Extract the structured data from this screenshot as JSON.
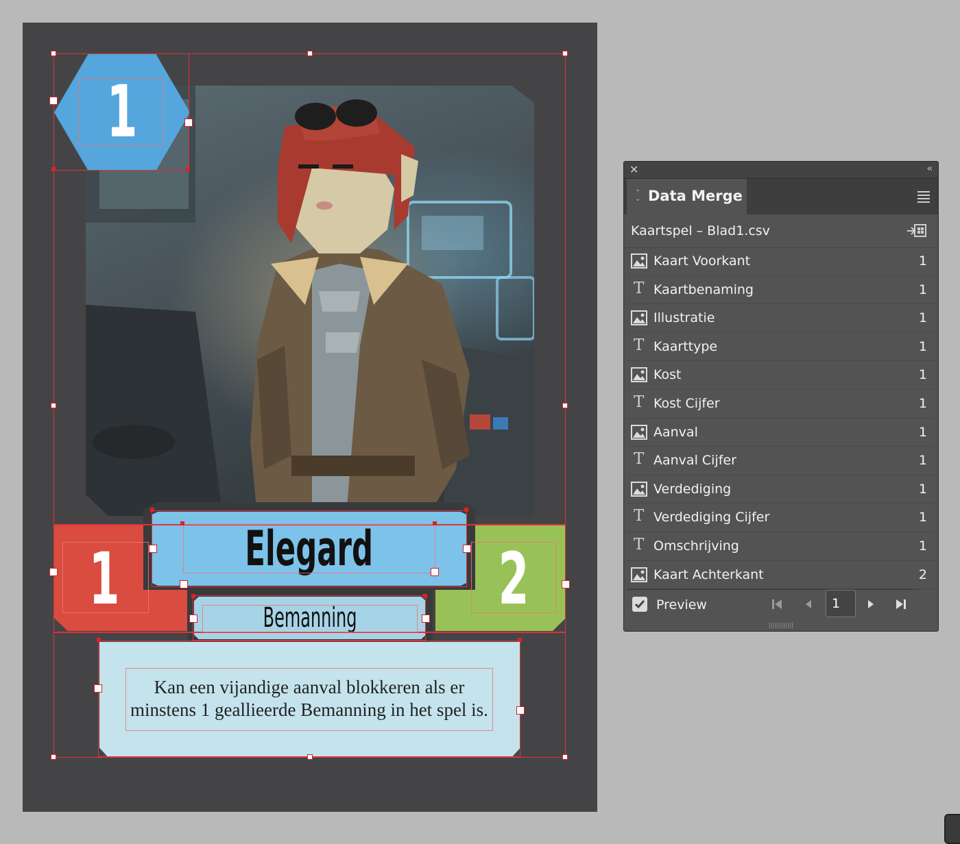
{
  "card": {
    "hex_number": "1",
    "cost_number": "1",
    "defense_number": "2",
    "name": "Elegard",
    "type": "Bemanning",
    "description": "Kan een vijandige aanval blokkeren als er minstens 1 geallieerde Bemanning in het spel is."
  },
  "panel": {
    "title": "Data Merge",
    "source": "Kaartspel – Blad1.csv",
    "fields": [
      {
        "kind": "image",
        "label": "Kaart Voorkant",
        "count": "1"
      },
      {
        "kind": "text",
        "label": "Kaartbenaming",
        "count": "1"
      },
      {
        "kind": "image",
        "label": "Illustratie",
        "count": "1"
      },
      {
        "kind": "text",
        "label": "Kaarttype",
        "count": "1"
      },
      {
        "kind": "image",
        "label": "Kost",
        "count": "1"
      },
      {
        "kind": "text",
        "label": "Kost Cijfer",
        "count": "1"
      },
      {
        "kind": "image",
        "label": "Aanval",
        "count": "1"
      },
      {
        "kind": "text",
        "label": "Aanval Cijfer",
        "count": "1"
      },
      {
        "kind": "image",
        "label": "Verdediging",
        "count": "1"
      },
      {
        "kind": "text",
        "label": "Verdediging Cijfer",
        "count": "1"
      },
      {
        "kind": "text",
        "label": "Omschrijving",
        "count": "1"
      },
      {
        "kind": "image",
        "label": "Kaart Achterkant",
        "count": "2"
      }
    ],
    "preview_label": "Preview",
    "preview_checked": true,
    "record_number": "1"
  },
  "colors": {
    "hex": "#54a6dd",
    "cost": "#d94c3f",
    "defense": "#98c257",
    "name_box": "#7dc2e8",
    "type_box": "#a6d4e6",
    "desc_box": "#c4e3ed",
    "selection": "#e0323a"
  },
  "icons": {
    "close": "close-icon",
    "collapse": "double-chevron-left-icon",
    "menu": "hamburger-menu-icon",
    "import": "import-data-source-icon",
    "image_field": "image-placeholder-icon",
    "text_field": "text-frame-icon",
    "nav": [
      "first-record-icon",
      "previous-record-icon",
      "next-record-icon",
      "last-record-icon"
    ]
  }
}
